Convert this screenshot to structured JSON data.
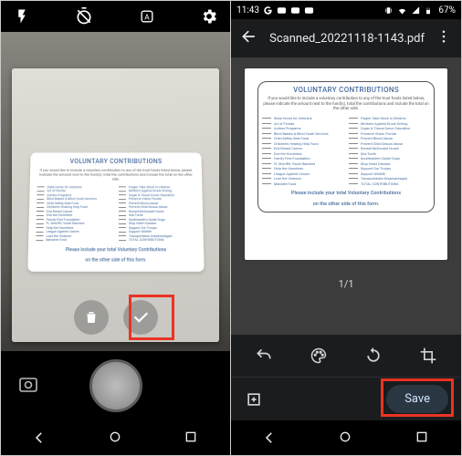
{
  "left": {
    "viewfinder_doc": {
      "title": "VOLUNTARY CONTRIBUTIONS",
      "sub": "If you would like to include a voluntary contribution to any of the trust funds listed below, please indicate the amount next to the fund(s), total the contributions and include the total on the other side.",
      "col1": [
        "State Home for Veterans",
        "Art of Florida",
        "Autism Programs",
        "Blind Babies & Blind Youth Services",
        "Child Safety Seat Fund",
        "Children's Hearing Help Fund",
        "End Breast Cancer",
        "End the Homeless",
        "Family First Foundation",
        "FL Sheriffs' Youth Ranches",
        "Help the Homeless",
        "League Against Cancer",
        "Lose the Violence",
        "Manatee Fund"
      ],
      "col2": [
        "Flagler Take Stock in Children",
        "Mothers Against Drunk Driving",
        "Organ & Tissue Donor Education",
        "Preserve Vision Florida",
        "Prevent Blood Abuse",
        "Prevent Child Sexual Abuse",
        "Ronald McDonald House",
        "Sea Turtle",
        "Southeastern Guide Dogs",
        "Stop Heart Disease",
        "Support Our Troops",
        "Support Wildlife",
        "Transportation Disadvantaged",
        "TOTAL CONTRIBUTIONS"
      ],
      "footer1": "Please include your total Voluntary Contributions",
      "footer2": "on the other side of this form."
    }
  },
  "right": {
    "status": {
      "time": "11:43",
      "battery": "67%"
    },
    "appbar": {
      "title": "Scanned_20221118-1143.pdf"
    },
    "viewer": {
      "page_indicator": "1/1"
    },
    "save_label": "Save"
  }
}
